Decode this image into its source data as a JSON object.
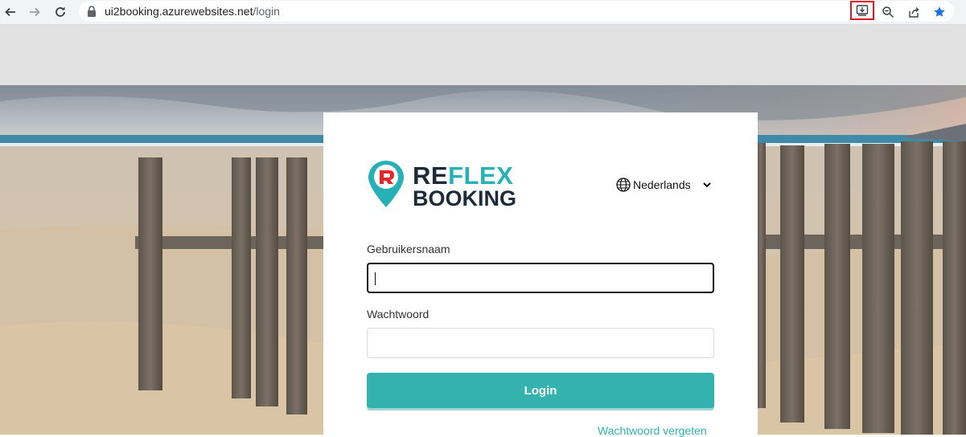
{
  "browser": {
    "url_domain": "ui2booking.azurewebsites.net",
    "url_path": "/login",
    "icons": [
      "back-arrow-icon",
      "forward-arrow-icon",
      "reload-icon",
      "lock-icon",
      "install-app-icon",
      "zoom-icon",
      "share-icon",
      "bookmark-star-icon"
    ]
  },
  "logo": {
    "line1_dark": "RE",
    "line1_teal": "FLEX",
    "line2": "BOOKING"
  },
  "language": {
    "selected": "Nederlands"
  },
  "form": {
    "username_label": "Gebruikersnaam",
    "username_value": "",
    "password_label": "Wachtwoord",
    "password_value": "",
    "login_label": "Login",
    "forgot_label": "Wachtwoord vergeten"
  },
  "colors": {
    "accent": "#33b2ae",
    "logo_dark": "#1d2a3a",
    "highlight": "#e0191c",
    "star": "#1a73e8"
  }
}
